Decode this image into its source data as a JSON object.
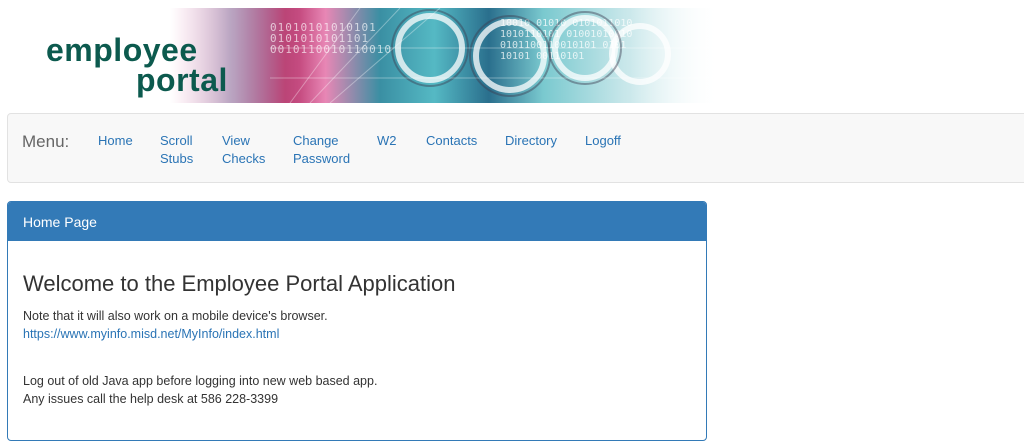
{
  "banner": {
    "logo_line1": "employee",
    "logo_line2": "portal",
    "binary_text_a": "01010101010101\n0101010101101\n0010110010110010",
    "binary_text_b": "10010 01010 0101011010\n1010110101 01001010010\n0101100110010101 0101\n10101 00110101"
  },
  "menu": {
    "label": "Menu:",
    "items": [
      {
        "label": "Home"
      },
      {
        "label": "Scroll\nStubs"
      },
      {
        "label": "View\nChecks"
      },
      {
        "label": "Change\nPassword"
      },
      {
        "label": "W2"
      },
      {
        "label": "Contacts"
      },
      {
        "label": "Directory"
      },
      {
        "label": "Logoff"
      }
    ]
  },
  "panel": {
    "heading": "Home Page",
    "welcome": "Welcome to the Employee Portal Application",
    "note": "Note that it will also work on a mobile device's browser.",
    "link": "https://www.myinfo.misd.net/MyInfo/index.html",
    "logout_note": "Log out of old Java app before logging into new web based app.",
    "help_note": "Any issues call the help desk at 586 228-3399"
  },
  "colors": {
    "logo": "#0c5a4e",
    "link": "#2a74b5",
    "panel_primary": "#337ab7",
    "menubar_bg": "#f8f8f8"
  }
}
